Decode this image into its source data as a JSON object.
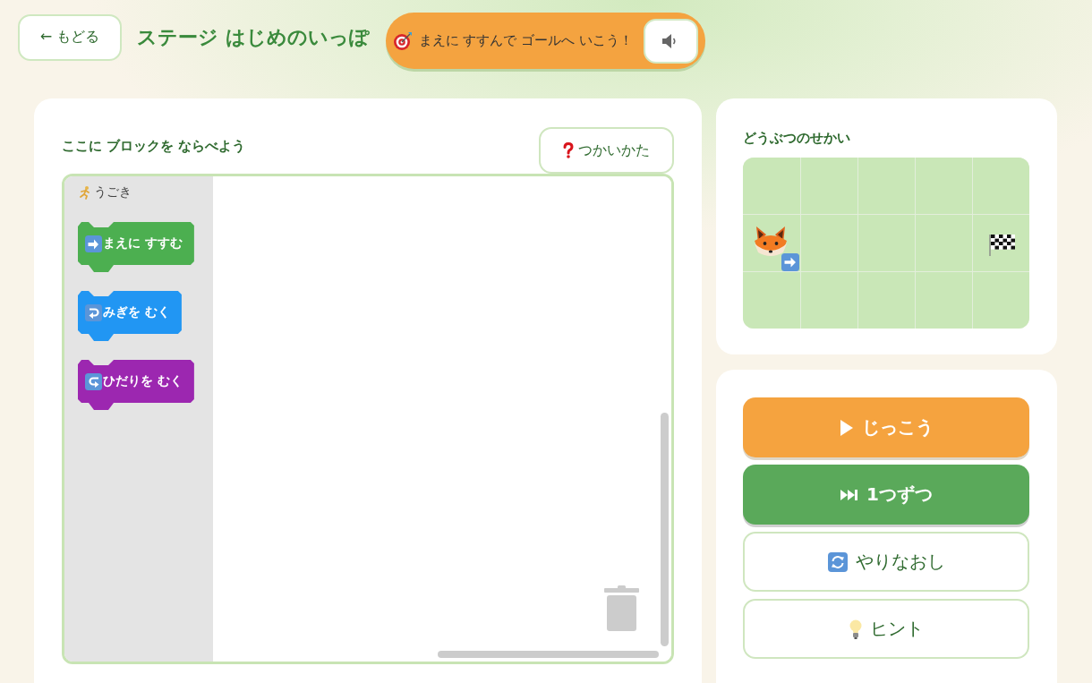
{
  "header": {
    "back_button": "← もどる",
    "stage_title": "ステージ はじめのいっぽ",
    "goal_banner": "まえに すすんで ゴールへ いこう！"
  },
  "editor": {
    "label": "ここに ブロックを ならべよう",
    "help_button": "つかいかた",
    "toolbox": {
      "category": "うごき",
      "blocks": [
        {
          "kind": "forward",
          "label": "まえに すすむ",
          "color": "#4caf50"
        },
        {
          "kind": "turn_right",
          "label": "みぎを むく",
          "color": "#2196f3"
        },
        {
          "kind": "turn_left",
          "label": "ひだりを むく",
          "color": "#9c27b0"
        }
      ]
    }
  },
  "world": {
    "title": "どうぶつのせかい",
    "rows": [
      {
        "cells": [
          {
            "kind": "empty"
          },
          {
            "kind": "empty"
          },
          {
            "kind": "empty"
          },
          {
            "kind": "empty"
          },
          {
            "kind": "empty"
          }
        ]
      },
      {
        "cells": [
          {
            "kind": "animal",
            "badge": {
              "kind": "arrow_right"
            }
          },
          {
            "kind": "empty"
          },
          {
            "kind": "empty"
          },
          {
            "kind": "empty"
          },
          {
            "kind": "goal"
          }
        ]
      },
      {
        "cells": [
          {
            "kind": "empty"
          },
          {
            "kind": "empty"
          },
          {
            "kind": "empty"
          },
          {
            "kind": "empty"
          },
          {
            "kind": "empty"
          }
        ]
      }
    ]
  },
  "controls": [
    {
      "kind": "run",
      "label": "じっこう"
    },
    {
      "kind": "step",
      "label": "1つずつ"
    },
    {
      "kind": "reset",
      "label": "やりなおし"
    },
    {
      "kind": "hint",
      "label": "ヒント"
    }
  ]
}
